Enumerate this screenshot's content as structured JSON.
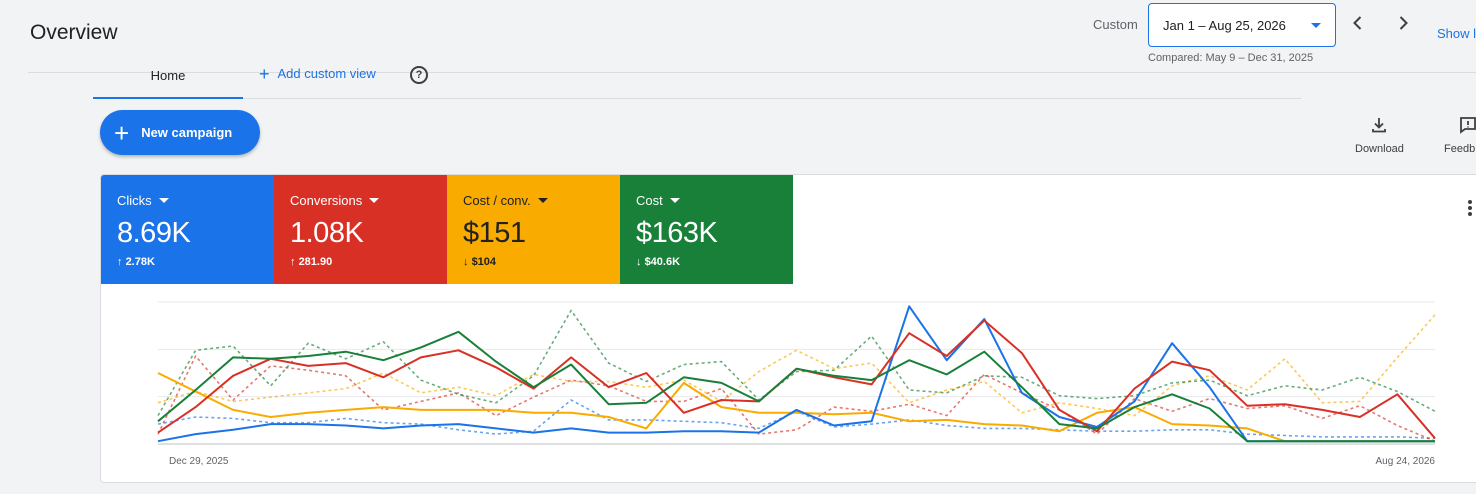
{
  "header": {
    "title": "Overview",
    "custom_label": "Custom",
    "date_range": "Jan 1 – Aug 25, 2026",
    "compared": "Compared: May 9 – Dec 31, 2025",
    "show_link": "Show l"
  },
  "tabs": {
    "home": "Home",
    "add_custom_view": "Add custom view"
  },
  "actions": {
    "new_campaign": "New campaign",
    "download": "Download",
    "feedback": "Feedb"
  },
  "metrics": [
    {
      "label": "Clicks",
      "value": "8.69K",
      "delta": "2.78K",
      "direction": "up",
      "color": "#1a73e8"
    },
    {
      "label": "Conversions",
      "value": "1.08K",
      "delta": "281.90",
      "direction": "up",
      "color": "#d93025"
    },
    {
      "label": "Cost / conv.",
      "value": "$151",
      "delta": "$104",
      "direction": "down",
      "color": "#f9ab00"
    },
    {
      "label": "Cost",
      "value": "$163K",
      "delta": "$40.6K",
      "direction": "down",
      "color": "#188038"
    }
  ],
  "chart_data": {
    "type": "line",
    "x_start_label": "Dec 29, 2025",
    "x_end_label": "Aug 24, 2026",
    "grid": true,
    "legend": "none",
    "series": [
      {
        "name": "Clicks",
        "color": "#1a73e8",
        "dashed": false,
        "values": [
          0.02,
          0.07,
          0.1,
          0.14,
          0.14,
          0.13,
          0.11,
          0.13,
          0.14,
          0.11,
          0.08,
          0.11,
          0.08,
          0.08,
          0.09,
          0.09,
          0.08,
          0.24,
          0.13,
          0.16,
          0.97,
          0.59,
          0.88,
          0.36,
          0.19,
          0.12,
          0.3,
          0.71,
          0.4,
          0.02,
          0.02,
          0.02,
          0.02,
          0.02,
          0.02
        ]
      },
      {
        "name": "Clicks (compared)",
        "color": "#1a73e8",
        "dashed": true,
        "values": [
          0.14,
          0.19,
          0.18,
          0.15,
          0.15,
          0.18,
          0.15,
          0.14,
          0.1,
          0.07,
          0.09,
          0.31,
          0.17,
          0.17,
          0.16,
          0.15,
          0.11,
          0.23,
          0.12,
          0.14,
          0.17,
          0.13,
          0.11,
          0.11,
          0.1,
          0.09,
          0.09,
          0.1,
          0.1,
          0.07,
          0.06,
          0.05,
          0.05,
          0.05,
          0.04
        ]
      },
      {
        "name": "Conversions",
        "color": "#d93025",
        "dashed": false,
        "values": [
          0.08,
          0.26,
          0.48,
          0.6,
          0.55,
          0.57,
          0.47,
          0.61,
          0.66,
          0.54,
          0.39,
          0.61,
          0.4,
          0.5,
          0.22,
          0.31,
          0.3,
          0.53,
          0.47,
          0.42,
          0.78,
          0.62,
          0.87,
          0.64,
          0.24,
          0.09,
          0.39,
          0.58,
          0.52,
          0.27,
          0.28,
          0.24,
          0.19,
          0.35,
          0.04
        ]
      },
      {
        "name": "Conversions (compared)",
        "color": "#d93025",
        "dashed": true,
        "values": [
          0.07,
          0.62,
          0.31,
          0.55,
          0.52,
          0.48,
          0.24,
          0.3,
          0.36,
          0.2,
          0.33,
          0.45,
          0.41,
          0.3,
          0.3,
          0.39,
          0.07,
          0.1,
          0.26,
          0.23,
          0.28,
          0.2,
          0.49,
          0.36,
          0.24,
          0.07,
          0.32,
          0.23,
          0.32,
          0.25,
          0.27,
          0.18,
          0.27,
          0.13,
          0.02
        ]
      },
      {
        "name": "Cost / conv.",
        "color": "#f9ab00",
        "dashed": false,
        "values": [
          0.5,
          0.37,
          0.24,
          0.19,
          0.22,
          0.24,
          0.26,
          0.24,
          0.24,
          0.24,
          0.22,
          0.22,
          0.19,
          0.11,
          0.43,
          0.26,
          0.22,
          0.22,
          0.21,
          0.22,
          0.16,
          0.17,
          0.14,
          0.13,
          0.09,
          0.22,
          0.26,
          0.14,
          0.13,
          0.11,
          0.02,
          0.02,
          0.02,
          0.02,
          0.02
        ]
      },
      {
        "name": "Cost / conv. (compared)",
        "color": "#f9ab00",
        "dashed": true,
        "values": [
          0.29,
          0.37,
          0.3,
          0.33,
          0.36,
          0.39,
          0.5,
          0.36,
          0.4,
          0.34,
          0.49,
          0.44,
          0.44,
          0.4,
          0.45,
          0.3,
          0.51,
          0.66,
          0.53,
          0.57,
          0.29,
          0.38,
          0.44,
          0.22,
          0.29,
          0.25,
          0.2,
          0.41,
          0.48,
          0.38,
          0.6,
          0.29,
          0.3,
          0.61,
          0.91
        ]
      },
      {
        "name": "Cost",
        "color": "#188038",
        "dashed": false,
        "values": [
          0.16,
          0.38,
          0.61,
          0.6,
          0.62,
          0.65,
          0.59,
          0.68,
          0.79,
          0.58,
          0.4,
          0.56,
          0.28,
          0.29,
          0.47,
          0.43,
          0.3,
          0.53,
          0.48,
          0.45,
          0.59,
          0.49,
          0.65,
          0.4,
          0.14,
          0.11,
          0.26,
          0.35,
          0.25,
          0.02,
          0.02,
          0.02,
          0.02,
          0.02,
          0.02
        ]
      },
      {
        "name": "Cost (compared)",
        "color": "#188038",
        "dashed": true,
        "values": [
          0.2,
          0.66,
          0.69,
          0.41,
          0.71,
          0.6,
          0.72,
          0.45,
          0.35,
          0.29,
          0.48,
          0.94,
          0.57,
          0.44,
          0.56,
          0.58,
          0.31,
          0.51,
          0.52,
          0.76,
          0.38,
          0.36,
          0.48,
          0.47,
          0.34,
          0.32,
          0.34,
          0.43,
          0.45,
          0.34,
          0.41,
          0.38,
          0.47,
          0.37,
          0.23
        ]
      }
    ]
  }
}
